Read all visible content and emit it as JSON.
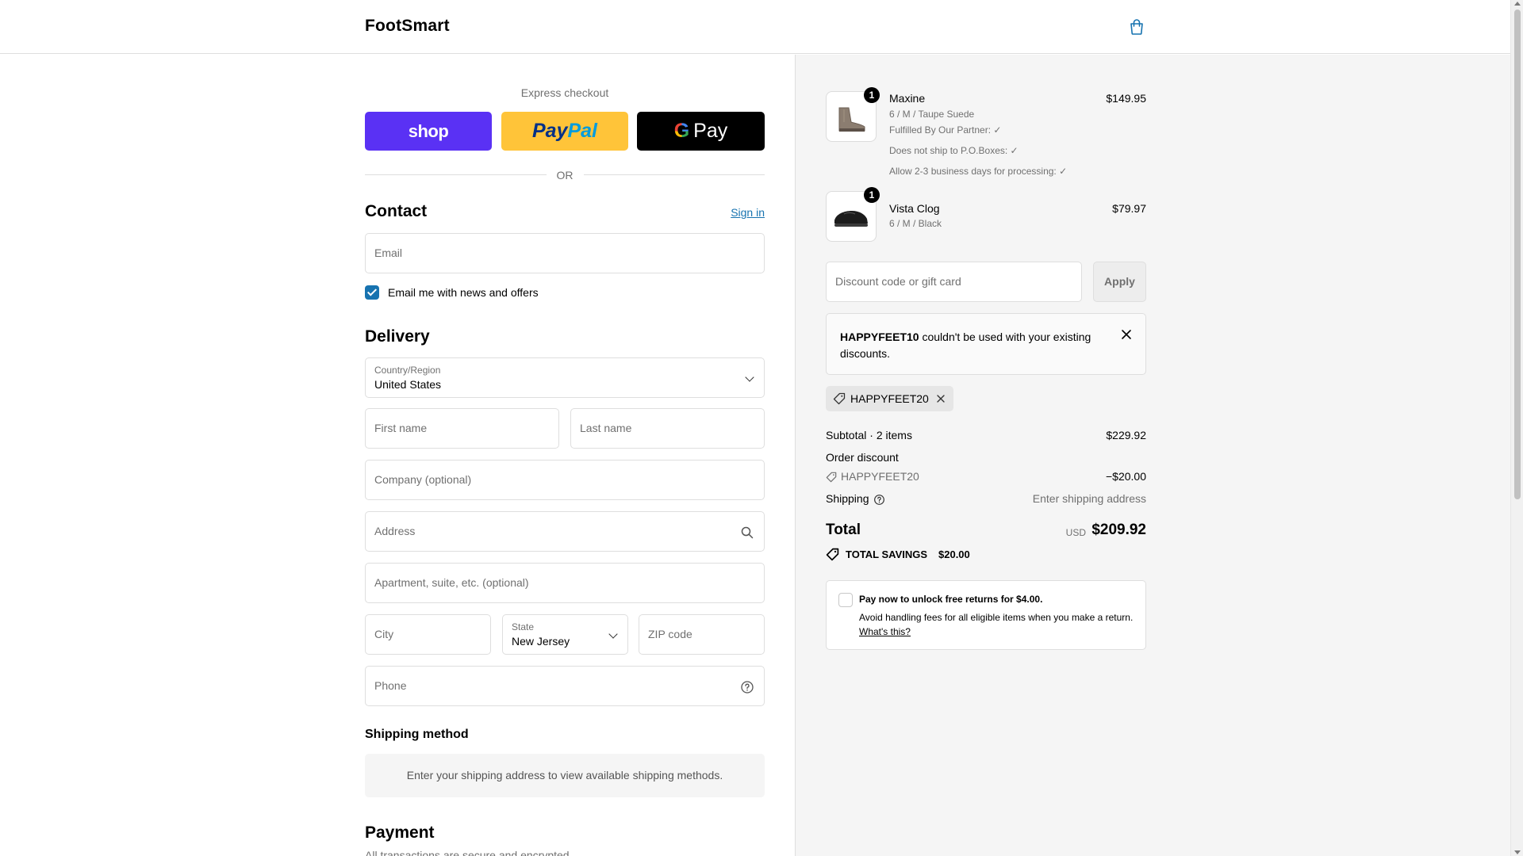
{
  "header": {
    "brand": "FootSmart",
    "cart_icon": "shopping-bag-icon"
  },
  "express": {
    "title": "Express checkout",
    "buttons": {
      "shop": "shop",
      "paypal_a": "Pay",
      "paypal_b": "Pal",
      "gpay_g": "G",
      "gpay_text": "Pay"
    },
    "or": "OR"
  },
  "contact": {
    "title": "Contact",
    "sign_in": "Sign in",
    "email_placeholder": "Email",
    "newsletter_label": "Email me with news and offers",
    "newsletter_checked": true
  },
  "delivery": {
    "title": "Delivery",
    "country_label": "Country/Region",
    "country_value": "United States",
    "first_name": "First name",
    "last_name": "Last name",
    "company": "Company (optional)",
    "address": "Address",
    "apartment": "Apartment, suite, etc. (optional)",
    "city": "City",
    "state_label": "State",
    "state_value": "New Jersey",
    "zip": "ZIP code",
    "phone": "Phone"
  },
  "shipping_method": {
    "title": "Shipping method",
    "message": "Enter your shipping address to view available shipping methods."
  },
  "payment": {
    "title": "Payment",
    "subtitle": "All transactions are secure and encrypted."
  },
  "cart": {
    "items": [
      {
        "qty": "1",
        "name": "Maxine",
        "variant": "6 / M / Taupe Suede",
        "notes": [
          "Fulfilled By Our Partner: ✓",
          "Does not ship to P.O.Boxes: ✓",
          "Allow 2-3 business days for processing: ✓"
        ],
        "price": "$149.95"
      },
      {
        "qty": "1",
        "name": "Vista Clog",
        "variant": "6 / M / Black",
        "notes": [],
        "price": "$79.97"
      }
    ],
    "discount_placeholder": "Discount code or gift card",
    "apply": "Apply",
    "alert_code": "HAPPYFEET10",
    "alert_text": " couldn't be used with your existing discounts.",
    "applied_code": "HAPPYFEET20",
    "subtotal_label": "Subtotal · 2 items",
    "subtotal_value": "$229.92",
    "order_discount_label": "Order discount",
    "discount_code": "HAPPYFEET20",
    "discount_value": "−$20.00",
    "shipping_label": "Shipping",
    "shipping_value": "Enter shipping address",
    "total_label": "Total",
    "currency": "USD",
    "total_value": "$209.92",
    "savings_label": "TOTAL SAVINGS",
    "savings_value": "$20.00",
    "returns_title": "Pay now to unlock free returns for $4.00.",
    "returns_text": "Avoid handling fees for all eligible items when you make a return.",
    "returns_link": "What's this?"
  }
}
